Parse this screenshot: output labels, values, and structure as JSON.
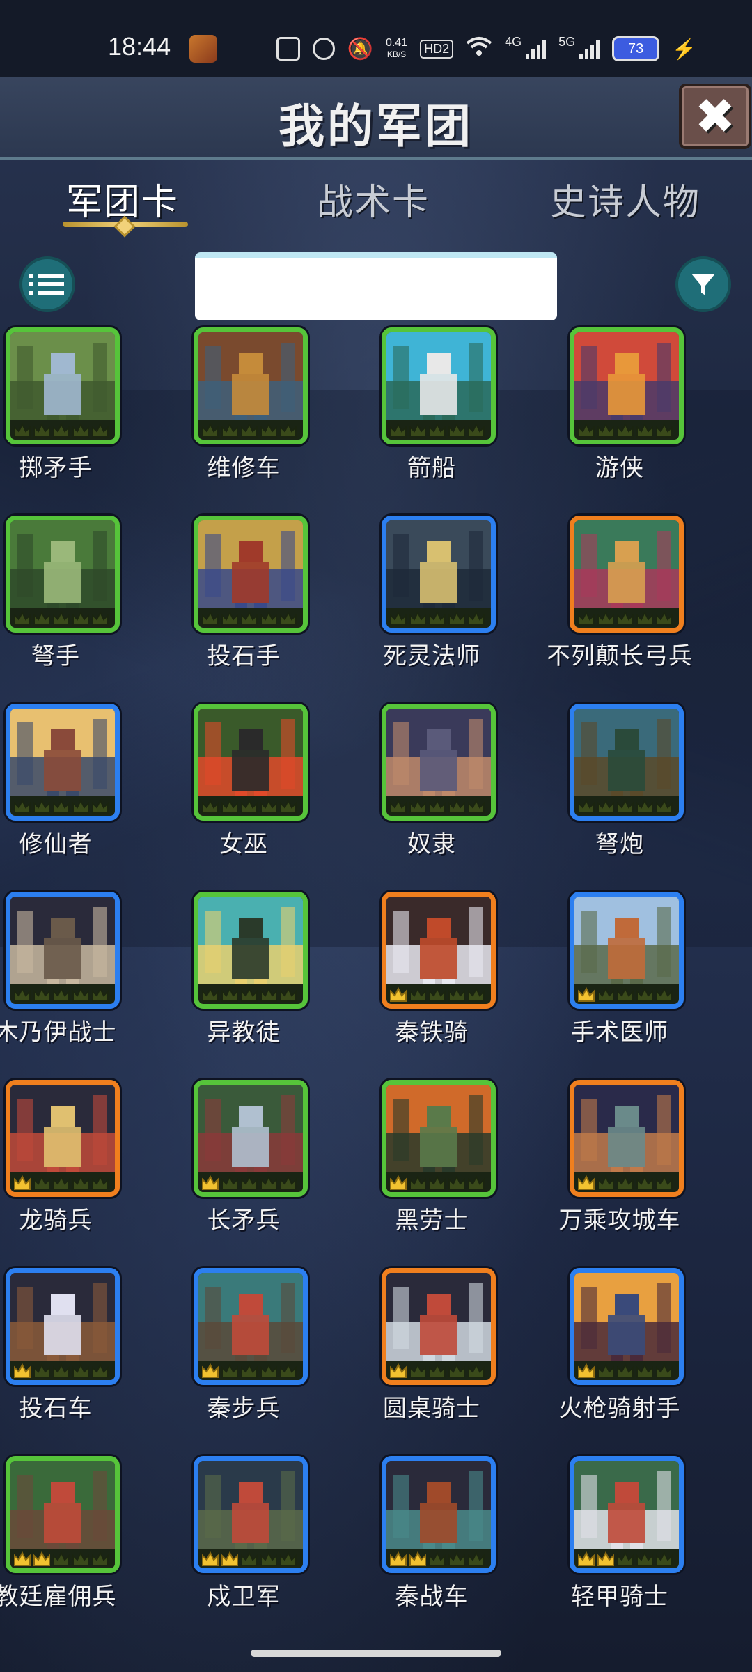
{
  "status_bar": {
    "time": "18:44",
    "speed_value": "0.41",
    "speed_unit": "KB/S",
    "hd": "HD2",
    "net1": "4G",
    "net2": "5G",
    "battery": "73"
  },
  "header": {
    "title": "我的军团",
    "close_label": "✖"
  },
  "tabs": [
    {
      "label": "军团卡",
      "active": true
    },
    {
      "label": "战术卡",
      "active": false
    },
    {
      "label": "史诗人物",
      "active": false
    }
  ],
  "search": {
    "value": ""
  },
  "cards": [
    {
      "name": "掷矛手",
      "rarity": "green",
      "crowns": 0,
      "colors": [
        "#6b8f4a",
        "#3f5a2e",
        "#a0b8d0"
      ]
    },
    {
      "name": "维修车",
      "rarity": "green",
      "crowns": 0,
      "colors": [
        "#7a4a2e",
        "#3e5f7a",
        "#c58b3a"
      ]
    },
    {
      "name": "箭船",
      "rarity": "green",
      "crowns": 0,
      "colors": [
        "#3fb4d6",
        "#2a6a5a",
        "#e8e8e8"
      ]
    },
    {
      "name": "游侠",
      "rarity": "green",
      "crowns": 0,
      "colors": [
        "#d04a3a",
        "#4a3a6a",
        "#e8983a"
      ]
    },
    {
      "name": "弩手",
      "rarity": "green",
      "crowns": 0,
      "colors": [
        "#4a7a3a",
        "#2e4a2a",
        "#9ab87a"
      ]
    },
    {
      "name": "投石手",
      "rarity": "green",
      "crowns": 0,
      "colors": [
        "#c4a04a",
        "#3a4a8a",
        "#a03a2a"
      ]
    },
    {
      "name": "死灵法师",
      "rarity": "blue",
      "crowns": 0,
      "colors": [
        "#3a4a5a",
        "#1e2a3a",
        "#d8c070"
      ]
    },
    {
      "name": "不列颠长弓兵",
      "rarity": "orange",
      "crowns": 0,
      "colors": [
        "#3a7a5a",
        "#a83a5a",
        "#d8a050"
      ]
    },
    {
      "name": "修仙者",
      "rarity": "blue",
      "crowns": 0,
      "colors": [
        "#e8c070",
        "#3a4a6a",
        "#8a4a3a"
      ]
    },
    {
      "name": "女巫",
      "rarity": "green",
      "crowns": 0,
      "colors": [
        "#3a5a2a",
        "#e04a2a",
        "#2a2a2a"
      ]
    },
    {
      "name": "奴隶",
      "rarity": "green",
      "crowns": 0,
      "colors": [
        "#3a3a5a",
        "#c08a6a",
        "#5a5a7a"
      ]
    },
    {
      "name": "弩炮",
      "rarity": "blue",
      "crowns": 0,
      "colors": [
        "#3a6a7a",
        "#5a4a2a",
        "#2a4a3a"
      ]
    },
    {
      "name": "木乃伊战士",
      "rarity": "blue",
      "crowns": 0,
      "colors": [
        "#2a2a3a",
        "#c8b8a0",
        "#6a5a4a"
      ]
    },
    {
      "name": "异教徒",
      "rarity": "green",
      "crowns": 0,
      "colors": [
        "#4ab0b0",
        "#e8d070",
        "#2a3a2a"
      ]
    },
    {
      "name": "秦铁骑",
      "rarity": "orange",
      "crowns": 1,
      "colors": [
        "#3a2a2a",
        "#e8e8f0",
        "#c04a2a"
      ]
    },
    {
      "name": "手术医师",
      "rarity": "blue",
      "crowns": 1,
      "colors": [
        "#a0c0e0",
        "#5a6a4a",
        "#c06a3a"
      ]
    },
    {
      "name": "龙骑兵",
      "rarity": "orange",
      "crowns": 1,
      "colors": [
        "#2a2a3a",
        "#c04a3a",
        "#e0c070"
      ]
    },
    {
      "name": "长矛兵",
      "rarity": "green",
      "crowns": 1,
      "colors": [
        "#3a5a3a",
        "#8a3a3a",
        "#b0c0d0"
      ]
    },
    {
      "name": "黑劳士",
      "rarity": "green",
      "crowns": 1,
      "colors": [
        "#d06a2a",
        "#2a3a2a",
        "#5a7a4a"
      ]
    },
    {
      "name": "万乘攻城车",
      "rarity": "orange",
      "crowns": 1,
      "colors": [
        "#2a2a4a",
        "#c07a4a",
        "#6a8a8a"
      ]
    },
    {
      "name": "投石车",
      "rarity": "blue",
      "crowns": 1,
      "colors": [
        "#2a2a3a",
        "#8a5a3a",
        "#e0e0f0"
      ]
    },
    {
      "name": "秦步兵",
      "rarity": "blue",
      "crowns": 1,
      "colors": [
        "#3a7a7a",
        "#5a4a3a",
        "#c04a3a"
      ]
    },
    {
      "name": "圆桌骑士",
      "rarity": "orange",
      "crowns": 1,
      "colors": [
        "#2a2a3a",
        "#d0d8e0",
        "#c04a3a"
      ]
    },
    {
      "name": "火枪骑射手",
      "rarity": "blue",
      "crowns": 1,
      "colors": [
        "#e8a040",
        "#4a2a3a",
        "#3a4a7a"
      ]
    },
    {
      "name": "教廷雇佣兵",
      "rarity": "green",
      "crowns": 2,
      "colors": [
        "#3a6a3a",
        "#6a4a3a",
        "#c04a3a"
      ]
    },
    {
      "name": "戍卫军",
      "rarity": "blue",
      "crowns": 2,
      "colors": [
        "#2a3a4a",
        "#5a6a4a",
        "#c04a3a"
      ]
    },
    {
      "name": "秦战车",
      "rarity": "blue",
      "crowns": 2,
      "colors": [
        "#2a2a3a",
        "#4a8a8a",
        "#a04a2a"
      ]
    },
    {
      "name": "轻甲骑士",
      "rarity": "blue",
      "crowns": 2,
      "colors": [
        "#3a6a4a",
        "#e0e0e8",
        "#c04a3a"
      ]
    }
  ],
  "colors": {
    "green": "#56c43a",
    "blue": "#2c7ff0",
    "orange": "#f07f1e",
    "teal_button": "#1f6e78",
    "gold": "#f2d27a"
  }
}
